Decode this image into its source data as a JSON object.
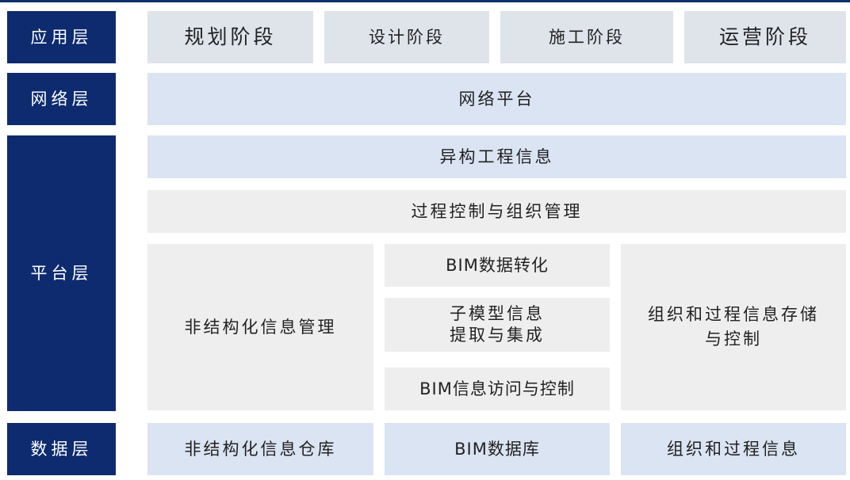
{
  "layers": {
    "application": "应用层",
    "network": "网络层",
    "platform": "平台层",
    "data": "数据层"
  },
  "application": {
    "planning": "规划阶段",
    "design": "设计阶段",
    "construction": "施工阶段",
    "operation": "运营阶段"
  },
  "network": {
    "platform": "网络平台"
  },
  "platform": {
    "heterogeneous": "异构工程信息",
    "process_control": "过程控制与组织管理",
    "unstructured_mgmt": "非结构化信息管理",
    "bim_conversion": "BIM数据转化",
    "submodel_line1": "子模型信息",
    "submodel_line2": "提取与集成",
    "bim_access": "BIM信息访问与控制",
    "org_storage_line1": "组织和过程信息存储",
    "org_storage_line2": "与控制"
  },
  "data": {
    "unstructured_repo": "非结构化信息仓库",
    "bim_db": "BIM数据库",
    "org_info": "组织和过程信息"
  },
  "colors": {
    "layer_label": "#0d2b6e",
    "gray_box": "#eeeeee",
    "application_box": "#dfe3ea",
    "blue_box": "#dbe4f3"
  }
}
